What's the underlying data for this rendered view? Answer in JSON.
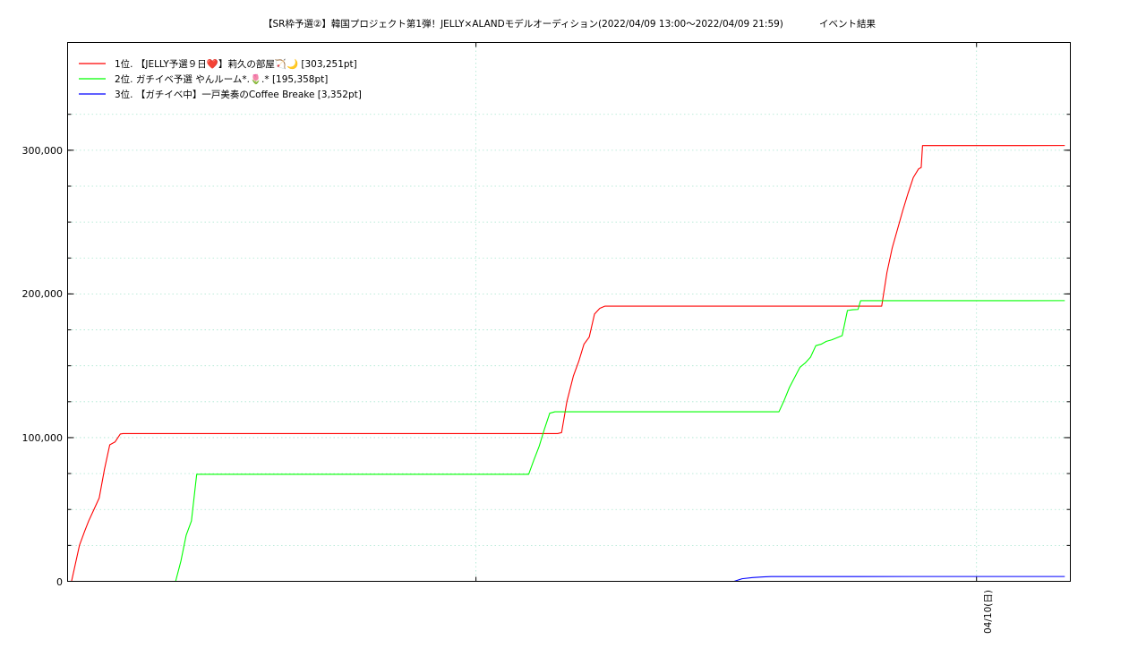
{
  "chart_data": {
    "type": "line",
    "title": "【SR枠予選②】韓国プロジェクト第1弾！JELLY×ALANDモデルオーディション(2022/04/09 13:00〜2022/04/09 21:59)",
    "subtitle": "イベント結果",
    "xlabel": "",
    "ylabel": "",
    "x_tick_labels": [
      "04/10(日)"
    ],
    "y_tick_labels": [
      "0",
      "100,000",
      "200,000",
      "300,000"
    ],
    "ylim": [
      0,
      300000
    ],
    "grid": true,
    "legend_position": "top-left",
    "series": [
      {
        "name": "1位. 【JELLY予選９日❤️】莉久の部屋🏹🌙 [303,251pt]",
        "color": "#ff0000",
        "points": [
          [
            0.3,
            0
          ],
          [
            0.9,
            25000
          ],
          [
            1.3,
            35000
          ],
          [
            1.6,
            42000
          ],
          [
            2.0,
            50000
          ],
          [
            2.4,
            58000
          ],
          [
            2.8,
            78000
          ],
          [
            3.2,
            95000
          ],
          [
            3.6,
            97000
          ],
          [
            4.0,
            102500
          ],
          [
            4.2,
            102800
          ],
          [
            10,
            102800
          ],
          [
            20,
            102800
          ],
          [
            30,
            102800
          ],
          [
            37.2,
            102800
          ],
          [
            37.5,
            103500
          ],
          [
            37.9,
            125000
          ],
          [
            38.4,
            143000
          ],
          [
            38.8,
            153000
          ],
          [
            39.2,
            165000
          ],
          [
            39.6,
            170000
          ],
          [
            40.0,
            186000
          ],
          [
            40.4,
            190000
          ],
          [
            40.8,
            191500
          ],
          [
            45,
            191500
          ],
          [
            55,
            191500
          ],
          [
            61.8,
            191500
          ],
          [
            62.2,
            215000
          ],
          [
            62.6,
            232000
          ],
          [
            63.0,
            245000
          ],
          [
            63.4,
            258000
          ],
          [
            63.8,
            270000
          ],
          [
            64.2,
            281000
          ],
          [
            64.6,
            287000
          ],
          [
            64.8,
            288000
          ],
          [
            64.9,
            303200
          ],
          [
            70,
            303200
          ],
          [
            75.7,
            303250
          ]
        ]
      },
      {
        "name": "2位. ガチイベ予選 やんルーム*.🌷.* [195,358pt]",
        "color": "#00ff00",
        "points": [
          [
            0,
            0
          ],
          [
            8.2,
            0
          ],
          [
            8.6,
            14000
          ],
          [
            9.0,
            32000
          ],
          [
            9.4,
            42000
          ],
          [
            9.8,
            74500
          ],
          [
            20,
            74500
          ],
          [
            30,
            74500
          ],
          [
            35.0,
            74500
          ],
          [
            35.4,
            84500
          ],
          [
            35.8,
            94000
          ],
          [
            36.2,
            106000
          ],
          [
            36.6,
            117000
          ],
          [
            37.0,
            118000
          ],
          [
            45,
            118000
          ],
          [
            54.0,
            118000
          ],
          [
            54.4,
            126000
          ],
          [
            54.8,
            135000
          ],
          [
            55.2,
            142000
          ],
          [
            55.6,
            149000
          ],
          [
            56.0,
            152000
          ],
          [
            56.4,
            156000
          ],
          [
            56.8,
            164000
          ],
          [
            57.2,
            165000
          ],
          [
            57.6,
            167000
          ],
          [
            58.0,
            168000
          ],
          [
            58.4,
            169500
          ],
          [
            58.8,
            171000
          ],
          [
            59.2,
            188500
          ],
          [
            59.6,
            189000
          ],
          [
            60.0,
            189200
          ],
          [
            60.2,
            195300
          ],
          [
            70,
            195300
          ],
          [
            75.7,
            195350
          ]
        ]
      },
      {
        "name": "3位. 【ガチイベ中】一戸美奏のCoffee Breake [3,352pt]",
        "color": "#0000ff",
        "points": [
          [
            0,
            0
          ],
          [
            50.6,
            0
          ],
          [
            51.2,
            1800
          ],
          [
            52.0,
            2600
          ],
          [
            52.8,
            3100
          ],
          [
            53.4,
            3300
          ],
          [
            60,
            3340
          ],
          [
            75.7,
            3352
          ]
        ]
      }
    ]
  }
}
